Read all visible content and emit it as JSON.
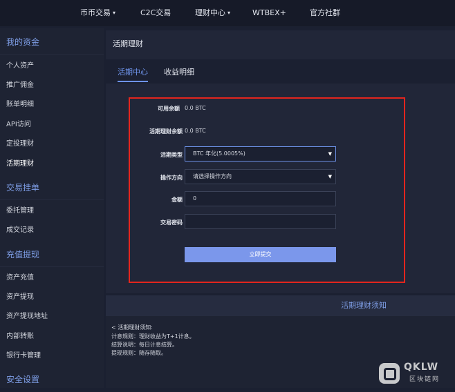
{
  "topnav": {
    "coin_trade": "币币交易",
    "c2c_trade": "C2C交易",
    "finance_center": "理财中心",
    "wtbex_plus": "WTBEX+",
    "community": "官方社群",
    "caret": "▾"
  },
  "sidebar": {
    "section_assets": "我的资金",
    "personal_assets": "个人资产",
    "referral": "推广佣金",
    "bills": "账单明细",
    "api": "API访问",
    "fixed_invest": "定投理财",
    "flexible_invest": "活期理财",
    "section_orders": "交易挂单",
    "orders_manage": "委托管理",
    "trade_records": "成交记录",
    "section_deposit": "充值提现",
    "deposit": "资产充值",
    "withdraw": "资产提现",
    "withdraw_address": "资产提现地址",
    "internal_transfer": "内部转账",
    "bank_cards": "银行卡管理",
    "section_security": "安全设置"
  },
  "header": {
    "title": "活期理财"
  },
  "tabs": {
    "center": "活期中心",
    "details": "收益明细"
  },
  "form": {
    "available_label": "可用余额",
    "available_value": "0.0 BTC",
    "invested_label": "活期理财余额",
    "invested_value": "0.0 BTC",
    "type_label": "活期类型",
    "type_value": "BTC   年化(5.0005%)",
    "direction_label": "操作方向",
    "direction_placeholder": "请选择操作方向",
    "amount_label": "金额",
    "amount_value": "0",
    "password_label": "交易密码",
    "password_value": "",
    "submit": "立即提交",
    "select_arrow": "▼"
  },
  "notice": {
    "title": "活期理财须知",
    "line1": "< 活期理财须知:",
    "line2": "计息规则：理财收益为T+1计息。",
    "line3": "结算说明：每日计息结算。",
    "line4": "提现规则：随存随取。"
  },
  "watermark": {
    "brand": "QKLW",
    "sub": "区块链网"
  },
  "colors": {
    "accent": "#6e93ea",
    "highlight_border": "#e3251d",
    "button": "#7b97eb"
  }
}
